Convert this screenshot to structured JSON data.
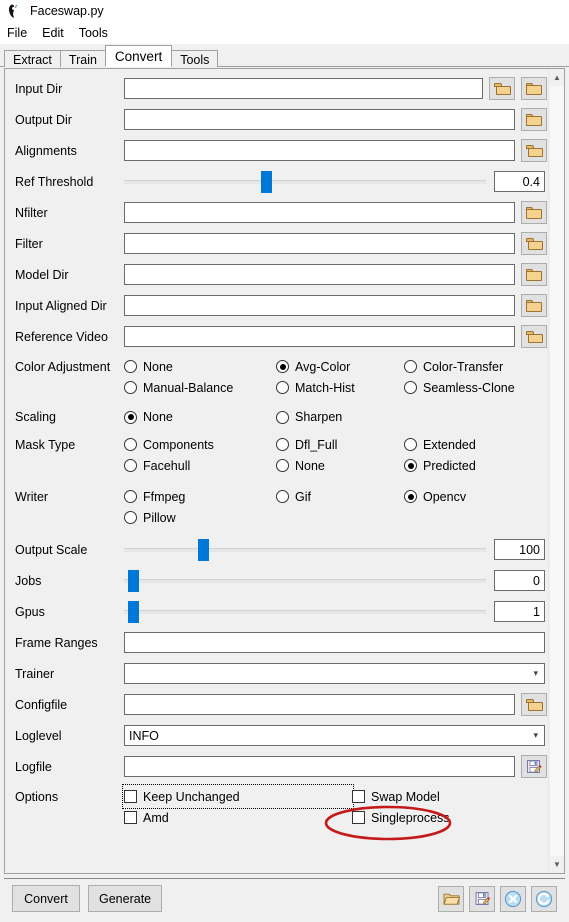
{
  "window": {
    "title": "Faceswap.py",
    "app_icon": "faceswap-logo-icon"
  },
  "menubar": {
    "items": [
      {
        "label": "File"
      },
      {
        "label": "Edit"
      },
      {
        "label": "Tools"
      }
    ]
  },
  "tabs": {
    "active": "Convert",
    "items": [
      {
        "label": "Extract"
      },
      {
        "label": "Train"
      },
      {
        "label": "Convert"
      },
      {
        "label": "Tools"
      }
    ]
  },
  "form": {
    "input_dir": {
      "label": "Input Dir",
      "value": ""
    },
    "output_dir": {
      "label": "Output Dir",
      "value": ""
    },
    "alignments": {
      "label": "Alignments",
      "value": ""
    },
    "ref_threshold": {
      "label": "Ref Threshold",
      "value": "0.4",
      "thumb_pct": 39
    },
    "nfilter": {
      "label": "Nfilter",
      "value": ""
    },
    "filter": {
      "label": "Filter",
      "value": ""
    },
    "model_dir": {
      "label": "Model Dir",
      "value": ""
    },
    "input_aligned_dir": {
      "label": "Input Aligned Dir",
      "value": ""
    },
    "reference_video": {
      "label": "Reference Video",
      "value": ""
    },
    "color_adjustment": {
      "label": "Color Adjustment",
      "selected": "Avg-Color",
      "options": [
        "None",
        "Avg-Color",
        "Color-Transfer",
        "Manual-Balance",
        "Match-Hist",
        "Seamless-Clone"
      ]
    },
    "scaling": {
      "label": "Scaling",
      "selected": "None",
      "options": [
        "None",
        "Sharpen"
      ]
    },
    "mask_type": {
      "label": "Mask Type",
      "selected": "Predicted",
      "options": [
        "Components",
        "Dfl_Full",
        "Extended",
        "Facehull",
        "None",
        "Predicted"
      ]
    },
    "writer": {
      "label": "Writer",
      "selected": "Opencv",
      "options": [
        "Ffmpeg",
        "Gif",
        "Opencv",
        "Pillow"
      ]
    },
    "output_scale": {
      "label": "Output Scale",
      "value": "100",
      "thumb_pct": 21
    },
    "jobs": {
      "label": "Jobs",
      "value": "0",
      "thumb_pct": 1
    },
    "gpus": {
      "label": "Gpus",
      "value": "1",
      "thumb_pct": 1
    },
    "frame_ranges": {
      "label": "Frame Ranges",
      "value": ""
    },
    "trainer": {
      "label": "Trainer",
      "value": ""
    },
    "configfile": {
      "label": "Configfile",
      "value": ""
    },
    "loglevel": {
      "label": "Loglevel",
      "value": "INFO"
    },
    "logfile": {
      "label": "Logfile",
      "value": ""
    },
    "options": {
      "label": "Options",
      "items": [
        {
          "label": "Keep Unchanged",
          "checked": false,
          "focused": true
        },
        {
          "label": "Swap Model",
          "checked": false,
          "focused": false
        },
        {
          "label": "Amd",
          "checked": false,
          "focused": false
        },
        {
          "label": "Singleprocess",
          "checked": false,
          "focused": false
        }
      ]
    }
  },
  "annotation": {
    "shape": "ellipse",
    "color": "#c41a1a",
    "targets": "Swap Model"
  },
  "bottom_toolbar": {
    "convert_label": "Convert",
    "generate_label": "Generate",
    "icons": [
      {
        "name": "open-folder-icon"
      },
      {
        "name": "save-as-icon"
      },
      {
        "name": "clear-icon"
      },
      {
        "name": "reload-icon"
      }
    ]
  },
  "icons": {
    "browse_folder_open": "folder-open-icon",
    "browse_folder": "folder-icon",
    "save_file": "save-as-icon",
    "chevron_down": "chevron-down-icon",
    "scroll_up": "chevron-up-icon",
    "scroll_down": "chevron-down-icon"
  }
}
